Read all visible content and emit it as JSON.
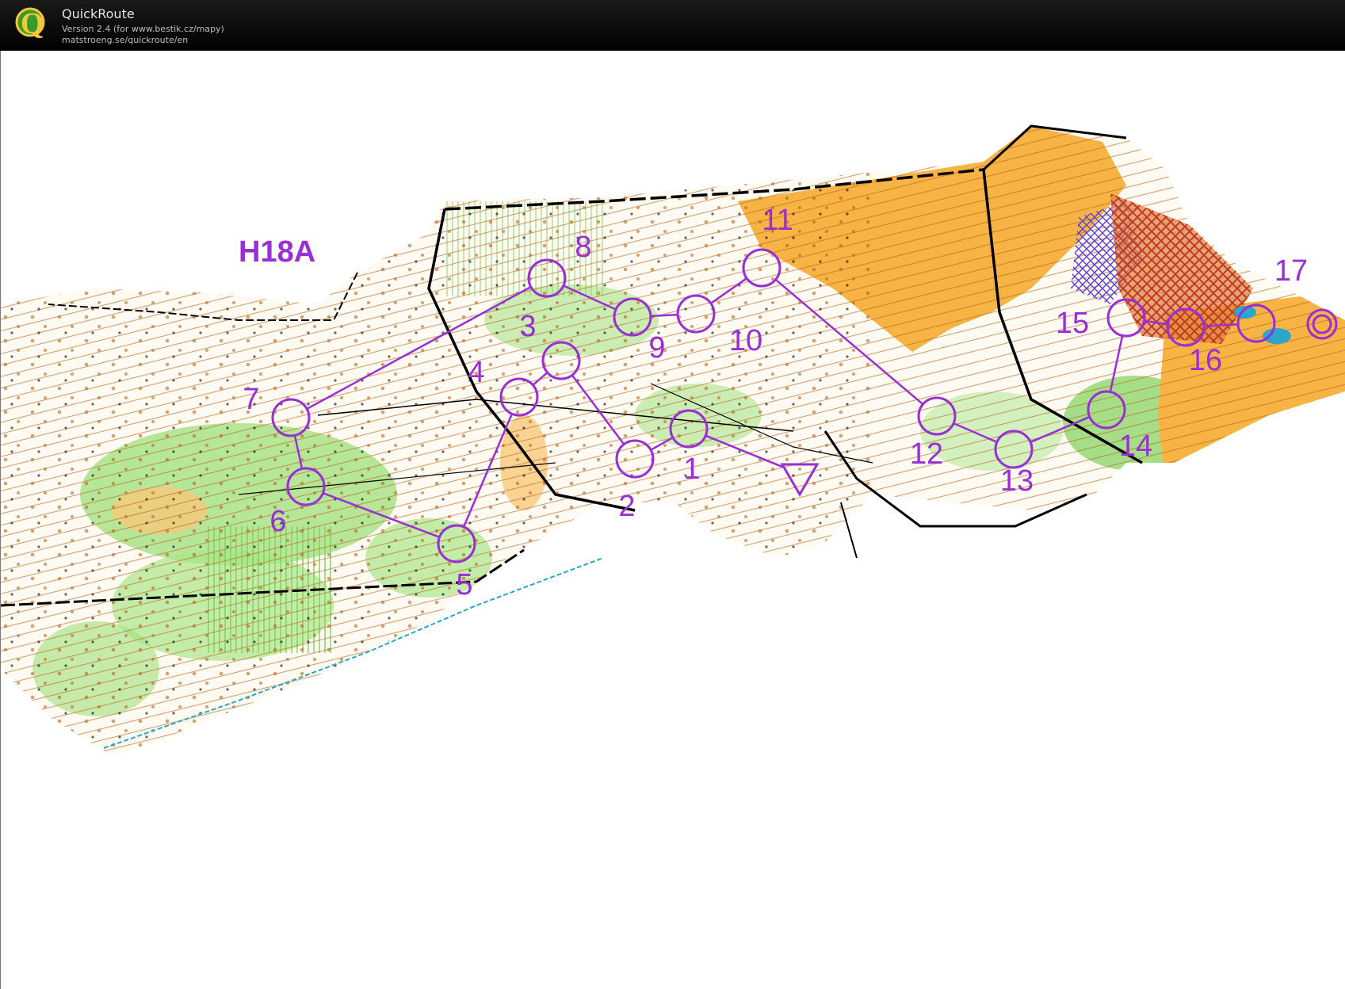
{
  "app": {
    "title": "QuickRoute",
    "version_text": "Version 2.4  (for www.bestik.cz/mapy)",
    "url_text": "matstroeng.se/quickroute/en",
    "logo_letter": "Q"
  },
  "map": {
    "course_name": "H18A",
    "colors": {
      "course": "#9a2fd6",
      "open_land": "#f7b343",
      "forest_green": "#7fd15a",
      "contours": "#b5651d",
      "roads": "#000000",
      "water": "#2aa7c9",
      "olb_hatch": "#c0392b"
    },
    "controls": [
      {
        "label": "1"
      },
      {
        "label": "2"
      },
      {
        "label": "3"
      },
      {
        "label": "4"
      },
      {
        "label": "5"
      },
      {
        "label": "6"
      },
      {
        "label": "7"
      },
      {
        "label": "8"
      },
      {
        "label": "9"
      },
      {
        "label": "10"
      },
      {
        "label": "11"
      },
      {
        "label": "12"
      },
      {
        "label": "13"
      },
      {
        "label": "14"
      },
      {
        "label": "15"
      },
      {
        "label": "16"
      },
      {
        "label": "17"
      }
    ]
  }
}
